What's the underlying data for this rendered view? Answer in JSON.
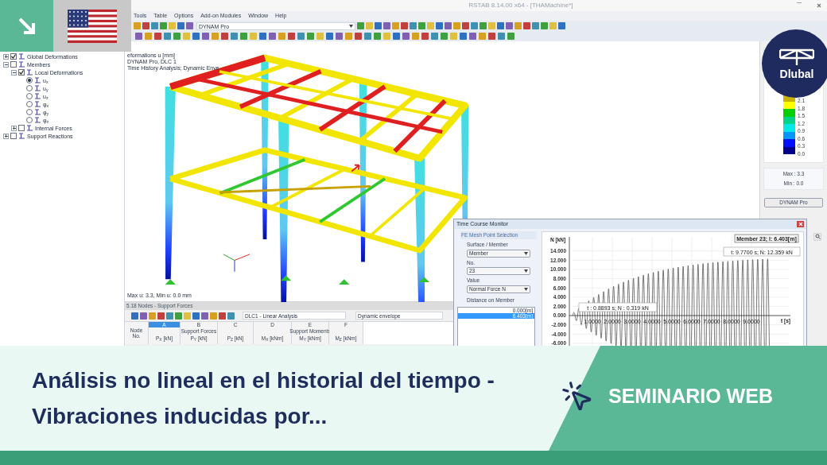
{
  "window": {
    "title": "RSTAB 8.14.00 x64 - [THAMachine*]"
  },
  "menu": [
    "Tools",
    "Table",
    "Options",
    "Add-on Modules",
    "Window",
    "Help"
  ],
  "toolbar": {
    "model_combo": "DYNAM Pro"
  },
  "navigator": [
    {
      "label": "Global Deformations",
      "kind": "checkbox",
      "checked": true,
      "expanded": false
    },
    {
      "label": "Members",
      "kind": "checkbox",
      "checked": false,
      "expanded": true,
      "children": [
        {
          "label": "Local Deformations",
          "kind": "checkbox",
          "checked": true,
          "expanded": true,
          "children": [
            {
              "label": "u$_{x}$",
              "kind": "radio",
              "selected": true
            },
            {
              "label": "u$_{y}$",
              "kind": "radio",
              "selected": false
            },
            {
              "label": "u$_{z}$",
              "kind": "radio",
              "selected": false
            },
            {
              "label": "φ$_{x}$",
              "kind": "radio",
              "selected": false
            },
            {
              "label": "φ$_{y}$",
              "kind": "radio",
              "selected": false
            },
            {
              "label": "φ$_{z}$",
              "kind": "radio",
              "selected": false
            }
          ]
        },
        {
          "label": "Internal Forces",
          "kind": "checkbox",
          "checked": false,
          "expanded": false
        }
      ]
    },
    {
      "label": "Support Reactions",
      "kind": "checkbox",
      "checked": false,
      "expanded": false
    }
  ],
  "view": {
    "info": [
      "eformations u [mm]",
      "DYNAM Pro, DLC 1",
      "Time History Analysis; Dynamic Enve"
    ],
    "footer": "Max u: 3.3, Min u: 0.0 mm"
  },
  "legend": {
    "bands": [
      {
        "color": "#c8b400",
        "label": "2.1"
      },
      {
        "color": "#ffff00",
        "label": "1.8"
      },
      {
        "color": "#00d000",
        "label": "1.5"
      },
      {
        "color": "#00d38a",
        "label": "1.2"
      },
      {
        "color": "#00e8e8",
        "label": "0.9"
      },
      {
        "color": "#0096ff",
        "label": "0.6"
      },
      {
        "color": "#0010ff",
        "label": "0.3"
      },
      {
        "color": "#00008c",
        "label": "0.0"
      }
    ],
    "max": "Max : 3.3",
    "min": "Min : 0.0",
    "button": "DYNAM Pro"
  },
  "table": {
    "title": "5.18 Nodes - Support Forces",
    "load_case": "DLC1 - Linear Analysis",
    "result": "Dynamic envelope",
    "node_header": "Node No.",
    "column_letters": [
      {
        "label": "A",
        "selected": true
      },
      {
        "label": "B",
        "selected": false
      },
      {
        "label": "C",
        "selected": false
      },
      {
        "label": "D",
        "selected": false
      },
      {
        "label": "E",
        "selected": false
      },
      {
        "label": "F",
        "selected": false
      }
    ],
    "groups": [
      "Support Forces",
      "Support Moments"
    ],
    "columns": [
      "P$_{X}$ [kN]",
      "P$_{Y}$ [kN]",
      "P$_{Z}$ [kN]",
      "M$_{X}$ [kNm]",
      "M$_{Y}$ [kNm]",
      "M$_{Z}$ [kNm]"
    ]
  },
  "dialog": {
    "title": "Time Course Monitor",
    "group": "FE Mesh Point Selection",
    "fields": [
      {
        "label": "Surface / Member",
        "value": "Member"
      },
      {
        "label": "No.",
        "value": "23"
      },
      {
        "label": "Value",
        "value": "Normal Force N"
      }
    ],
    "distance_label": "Distance on Member",
    "distances": [
      {
        "label": "0.000[m]",
        "selected": false
      },
      {
        "label": "6.403[m]",
        "selected": true
      }
    ],
    "plot": {
      "ylabel": "N [kN]",
      "xlabel": "t [s]",
      "yticks": [
        "14.000",
        "12.000",
        "10.000",
        "8.000",
        "6.000",
        "4.000",
        "2.000",
        "0.000",
        "-2.000",
        "-4.000",
        "-6.000"
      ],
      "xticks": [
        "1.0000",
        "2.0000",
        "3.0000",
        "4.0000",
        "5.0000",
        "6.0000",
        "7.0000",
        "8.0000",
        "9.0000"
      ],
      "member_label": "Member 23; l: 6.403[m]",
      "peak_label": "t: 9.7700 s; N: 12.359 kN",
      "cursor_label": "t : 0.8893 s; N : 0.319 kN"
    }
  },
  "logo": {
    "text": "Dlubal"
  },
  "banner": {
    "title": "Análisis no lineal en el historial del tiempo - Vibraciones inducidas por...",
    "tag": "SEMINARIO WEB"
  }
}
